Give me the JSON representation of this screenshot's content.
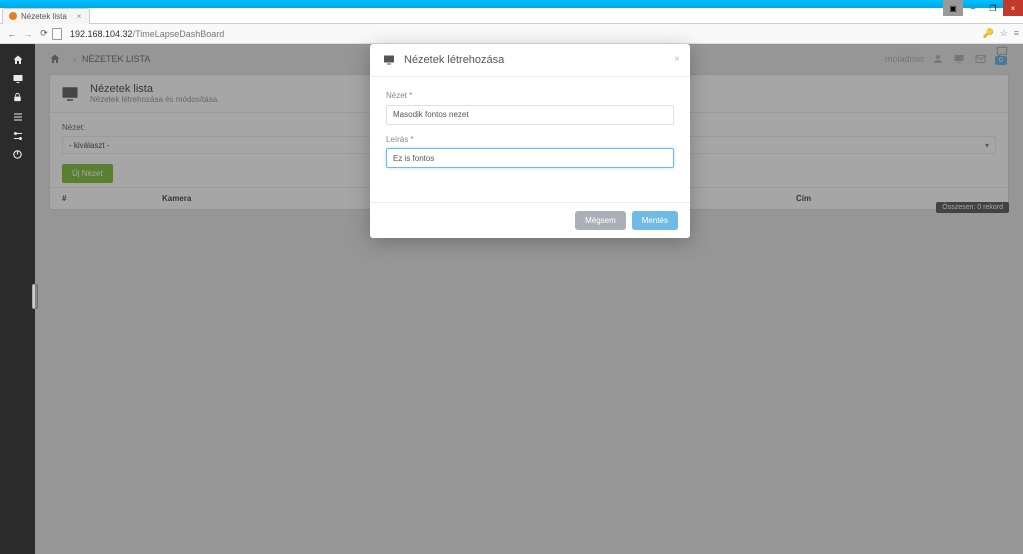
{
  "browser": {
    "tab_title": "Nézetek lista",
    "url_host": "192.168.104.32",
    "url_path": "/TimeLapseDashBoard"
  },
  "header": {
    "breadcrumb": "NÉZETEK LISTA",
    "username": "moladmin",
    "badge": "0"
  },
  "panel": {
    "title": "Nézetek lista",
    "subtitle": "Nézetek létrehozása és módosítása.",
    "select_label": "Nézet:",
    "select_value": "- kiválaszt -",
    "new_button": "Új Nézet"
  },
  "table": {
    "col_num": "#",
    "col_camera": "Kamera",
    "col_cim": "Cím",
    "records": "Összesen: 0 rekord"
  },
  "modal": {
    "title": "Nézetek létrehozása",
    "field1_label": "Nézet *",
    "field1_value": "Masodik fontos nezet",
    "field2_label": "Leírás *",
    "field2_value": "Ez is fontos",
    "cancel": "Mégsem",
    "save": "Mentés"
  }
}
